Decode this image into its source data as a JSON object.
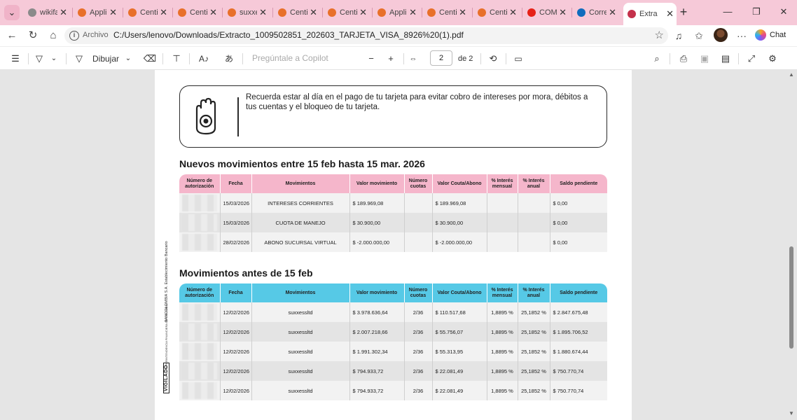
{
  "browser": {
    "tabs": [
      {
        "label": "wikifa",
        "icon": "search-icon",
        "color": "#8a8a8a"
      },
      {
        "label": "Appli",
        "icon": "pink-favicon",
        "color": "#e8702a"
      },
      {
        "label": "Centi",
        "icon": "pink-favicon",
        "color": "#e8702a"
      },
      {
        "label": "Centi",
        "icon": "pink-favicon",
        "color": "#e8702a"
      },
      {
        "label": "suxxe",
        "icon": "pink-favicon",
        "color": "#e8702a"
      },
      {
        "label": "Centi",
        "icon": "pink-favicon",
        "color": "#e8702a"
      },
      {
        "label": "Centi",
        "icon": "pink-favicon",
        "color": "#e8702a"
      },
      {
        "label": "Appli",
        "icon": "pink-favicon",
        "color": "#e8702a"
      },
      {
        "label": "Centi",
        "icon": "pink-favicon",
        "color": "#e8702a"
      },
      {
        "label": "Centi",
        "icon": "pink-favicon",
        "color": "#e8702a"
      },
      {
        "label": "COM",
        "icon": "youtube-icon",
        "color": "#e62117"
      },
      {
        "label": "Corre",
        "icon": "outlook-icon",
        "color": "#0f6cbd"
      },
      {
        "label": "Extra",
        "icon": "pdf-icon",
        "color": "#c4314b",
        "active": true
      }
    ],
    "new_tab": "+",
    "address": {
      "scheme": "Archivo",
      "url": "C:/Users/lenovo/Downloads/Extracto_1009502851_202603_TARJETA_VISA_8926%20(1).pdf"
    },
    "chat_label": "Chat"
  },
  "pdf_toolbar": {
    "draw_label": "Dibujar",
    "ask_copilot_placeholder": "Pregúntale a Copilot",
    "current_page": "2",
    "page_count": "de 2",
    "zoom_out": "−",
    "zoom_in": "+"
  },
  "document": {
    "notice": "Recuerda estar al día en el pago de tu tarjeta para evitar cobro de intereses por mora, débitos a tus cuentas y el bloqueo de tu tarjeta.",
    "section1_title": "Nuevos movimientos entre 15 feb hasta 15 mar. 2026",
    "section2_title": "Movimientos antes de 15 feb",
    "side_text": "BANCOLOMBIA S.A. Establecimiento Bancario",
    "side_text_small": "SUPERINTENDENCIA FINANCIERA DE COLOMBIA",
    "vigilado": "VIGILADO",
    "columns": [
      "Número de autorización",
      "Fecha",
      "Movimientos",
      "Valor movimiento",
      "Número cuotas",
      "Valor Couta/Abono",
      "% Interés mensual",
      "% Interés anual",
      "Saldo pendiente"
    ],
    "table1_rows": [
      {
        "auth": "",
        "fecha": "15/03/2026",
        "mov": "INTERESES CORRIENTES",
        "valor": "$ 189.969,08",
        "cuotas": "",
        "couta": "$ 189.969,08",
        "im": "",
        "ia": "",
        "saldo": "$ 0,00"
      },
      {
        "auth": "",
        "fecha": "15/03/2026",
        "mov": "CUOTA DE MANEJO",
        "valor": "$ 30.900,00",
        "cuotas": "",
        "couta": "$ 30.900,00",
        "im": "",
        "ia": "",
        "saldo": "$ 0,00"
      },
      {
        "auth": "",
        "fecha": "28/02/2026",
        "mov": "ABONO SUCURSAL VIRTUAL",
        "valor": "$ -2.000.000,00",
        "cuotas": "",
        "couta": "$ -2.000.000,00",
        "im": "",
        "ia": "",
        "saldo": "$ 0,00"
      }
    ],
    "table2_rows": [
      {
        "auth": "",
        "fecha": "12/02/2026",
        "mov": "suxxessltd",
        "valor": "$ 3.978.636,64",
        "cuotas": "2/36",
        "couta": "$ 110.517,68",
        "im": "1,8895 %",
        "ia": "25,1852 %",
        "saldo": "$ 2.847.675,48"
      },
      {
        "auth": "",
        "fecha": "12/02/2026",
        "mov": "suxxessltd",
        "valor": "$ 2.007.218,66",
        "cuotas": "2/36",
        "couta": "$ 55.756,07",
        "im": "1,8895 %",
        "ia": "25,1852 %",
        "saldo": "$ 1.895.706,52"
      },
      {
        "auth": "",
        "fecha": "12/02/2026",
        "mov": "suxxessltd",
        "valor": "$ 1.991.302,34",
        "cuotas": "2/36",
        "couta": "$ 55.313,95",
        "im": "1,8895 %",
        "ia": "25,1852 %",
        "saldo": "$ 1.880.674,44"
      },
      {
        "auth": "",
        "fecha": "12/02/2026",
        "mov": "suxxessltd",
        "valor": "$ 794.933,72",
        "cuotas": "2/36",
        "couta": "$ 22.081,49",
        "im": "1,8895 %",
        "ia": "25,1852 %",
        "saldo": "$ 750.770,74"
      },
      {
        "auth": "",
        "fecha": "12/02/2026",
        "mov": "suxxessltd",
        "valor": "$ 794.933,72",
        "cuotas": "2/36",
        "couta": "$ 22.081,49",
        "im": "1,8895 %",
        "ia": "25,1852 %",
        "saldo": "$ 750.770,74"
      }
    ]
  },
  "colors": {
    "browser_frame": "#f6c9d8",
    "table1_header": "#f5b6cb",
    "table2_header": "#56c9e6"
  }
}
